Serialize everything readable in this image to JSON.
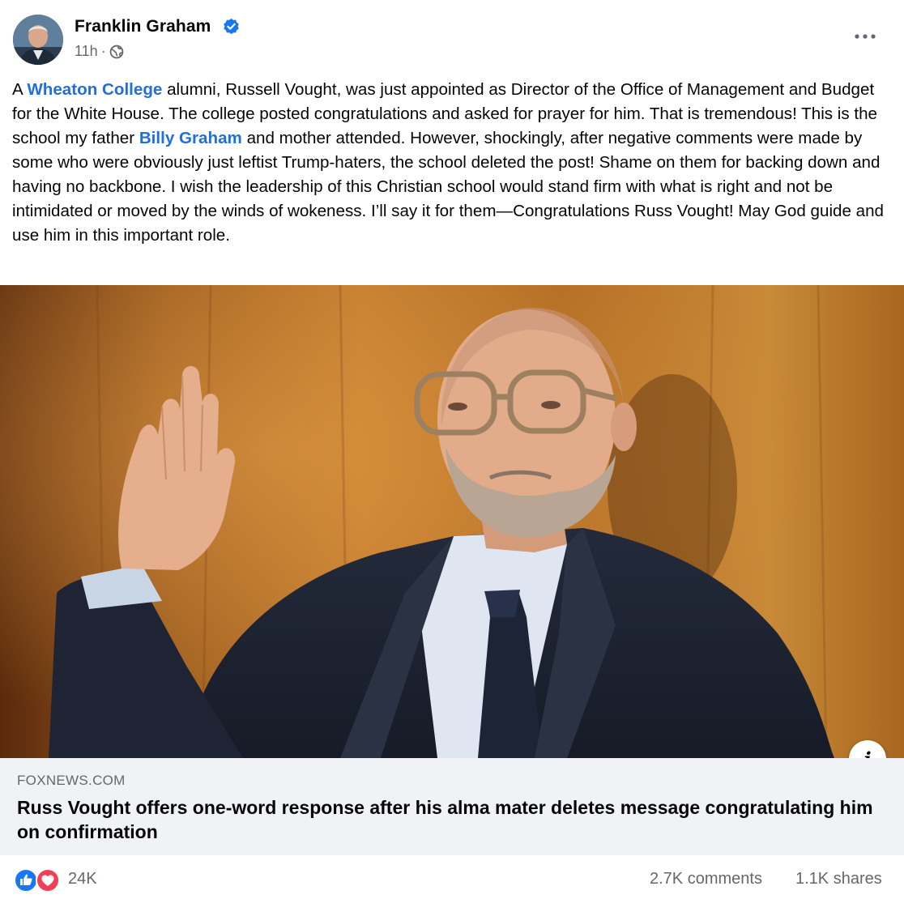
{
  "post": {
    "author": "Franklin Graham",
    "timestamp": "11h",
    "separator": "·",
    "audience_icon": "globe-icon",
    "verified_icon": "verified-badge-icon",
    "more_icon": "more-options-icon",
    "text": {
      "p1": "A ",
      "link1": "Wheaton College",
      "p2": " alumni, Russell Vought, was just appointed as Director of the Office of Management and Budget for the White House. The college posted congratulations and asked for prayer for him. That is tremendous! This is the school my father ",
      "link2": "Billy Graham",
      "p3": " and mother attended. However, shockingly, after negative comments were made by some who were obviously just leftist Trump-haters, the school deleted the post! Shame on them for backing down and having no backbone. I wish the leadership of this Christian school would stand firm with what is right and not be intimidated or moved by the winds of wokeness. I’ll say it for them—Congratulations Russ Vought! May God guide and use him in this important role."
    }
  },
  "link_preview": {
    "domain": "FOXNEWS.COM",
    "title": "Russ Vought offers one-word response after his alma mater deletes message congratulating him on confirmation",
    "info_label": "i"
  },
  "engagement": {
    "reactions": "24K",
    "reaction_icons": [
      "like-icon",
      "love-icon"
    ],
    "comments": "2.7K comments",
    "shares": "1.1K shares"
  },
  "colors": {
    "link": "#216fdb",
    "meta": "#65676b",
    "card_bg": "#f0f2f5",
    "like": "#1877f2",
    "love": "#f33e58"
  }
}
